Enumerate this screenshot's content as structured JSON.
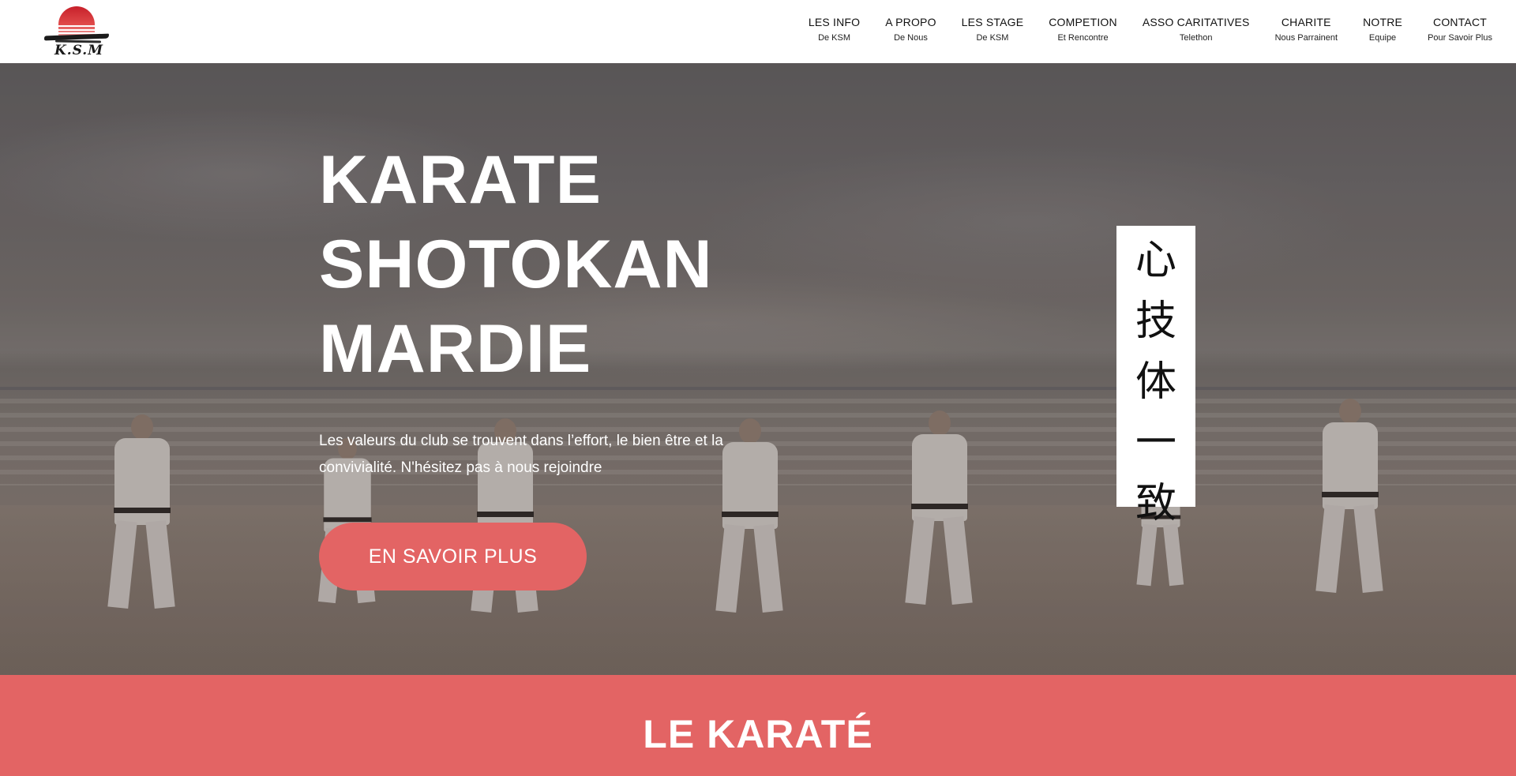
{
  "header": {
    "logo_text": "K.S.M",
    "nav": [
      {
        "label": "LES INFO",
        "sub": "De KSM"
      },
      {
        "label": "A PROPO",
        "sub": "De Nous"
      },
      {
        "label": "LES STAGE",
        "sub": "De KSM"
      },
      {
        "label": "COMPETION",
        "sub": "Et Rencontre"
      },
      {
        "label": "ASSO CARITATIVES",
        "sub": "Telethon"
      },
      {
        "label": "CHARITE",
        "sub": "Nous Parrainent"
      },
      {
        "label": "NOTRE",
        "sub": "Equipe"
      },
      {
        "label": "CONTACT",
        "sub": "Pour Savoir Plus"
      }
    ]
  },
  "hero": {
    "title_lines": [
      "KARATE",
      "SHOTOKAN",
      "MARDIE"
    ],
    "text": "Les valeurs du club se trouvent dans l’effort, le bien être et la convivialité. N'hésitez pas à nous rejoindre",
    "button": "EN SAVOIR PLUS",
    "scroll_kanji": [
      "心",
      "技",
      "体",
      "一",
      "致"
    ]
  },
  "band": {
    "title": "LE KARATÉ"
  },
  "colors": {
    "accent": "#e36464",
    "header_bg": "#ffffff",
    "text_light": "#ffffff"
  }
}
